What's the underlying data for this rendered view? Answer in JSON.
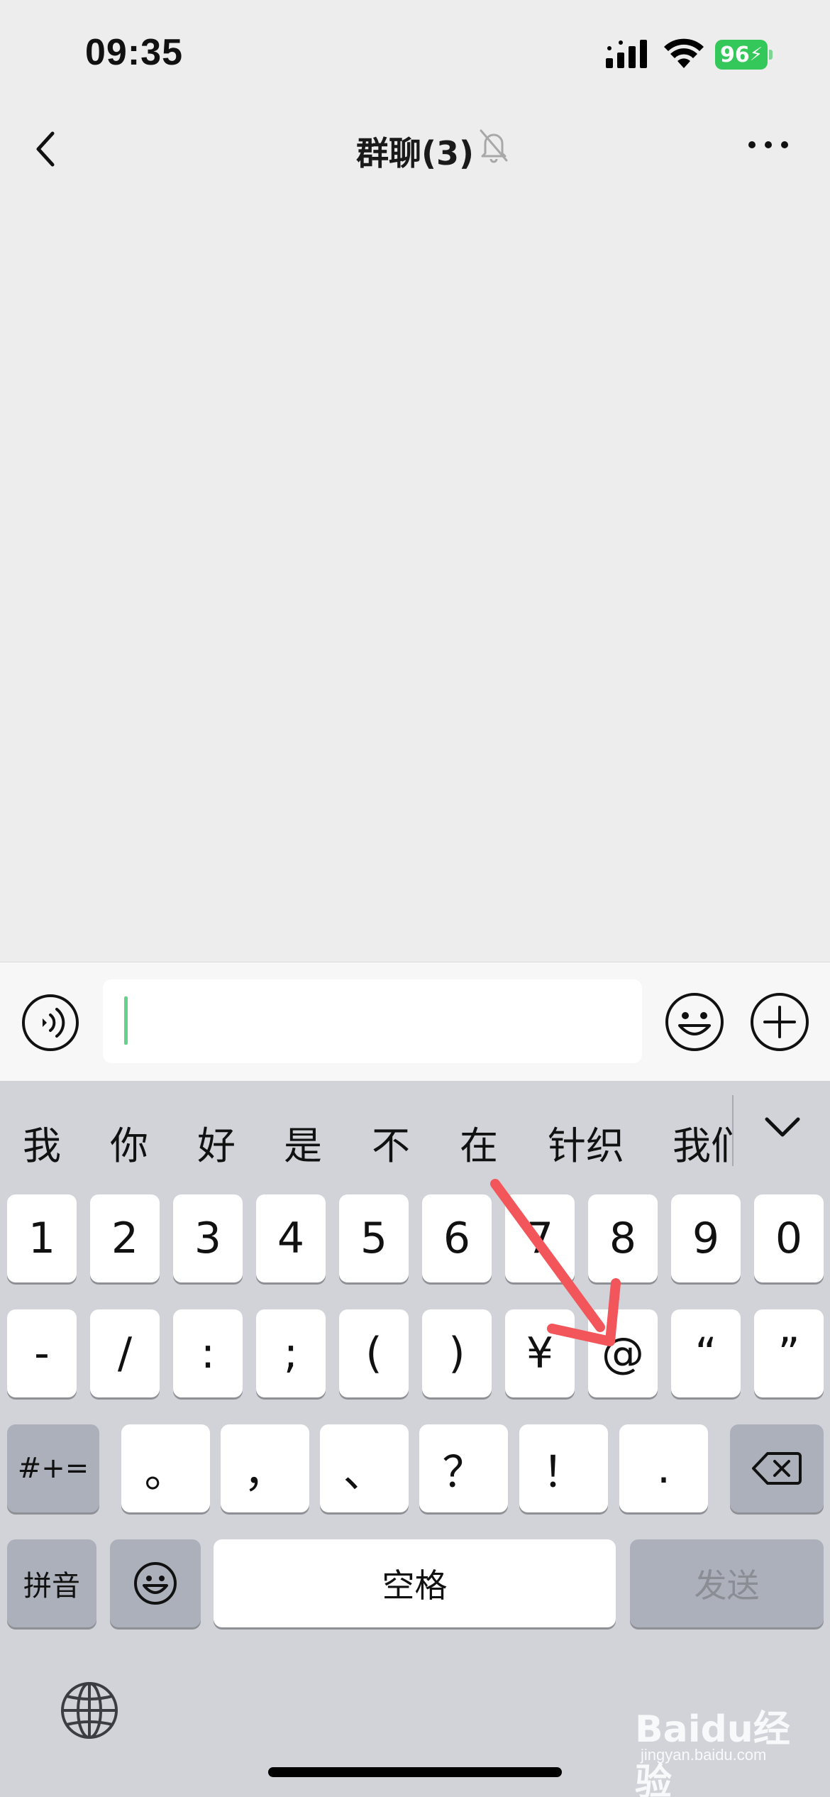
{
  "status_bar": {
    "time": "09:35",
    "battery_level": "96",
    "battery_color": "#34c759"
  },
  "nav": {
    "title": "群聊(3)",
    "back_icon": "chevron-left-icon",
    "mute_icon": "bell-slash-icon",
    "more_icon": "ellipsis-icon"
  },
  "input_bar": {
    "value": "",
    "caret_color": "#63d28a",
    "left_icon": "voice-icon",
    "right_icons": [
      "emoji-icon",
      "plus-circle-icon"
    ]
  },
  "keyboard": {
    "candidates": [
      "我",
      "你",
      "好",
      "是",
      "不",
      "在",
      "针织",
      "我们"
    ],
    "row1": [
      "1",
      "2",
      "3",
      "4",
      "5",
      "6",
      "7",
      "8",
      "9",
      "0"
    ],
    "row2": [
      "-",
      "/",
      ":",
      ";",
      "(",
      ")",
      "¥",
      "@",
      "“",
      "”"
    ],
    "row3": {
      "mode_key": "#+=",
      "keys": [
        "。",
        "，",
        "、",
        "？",
        "！",
        "."
      ],
      "delete_icon": "backspace-icon"
    },
    "row4": {
      "pinyin": "拼音",
      "emoji_icon": "emoji-icon",
      "space": "空格",
      "send": "发送"
    },
    "globe_icon": "globe-icon"
  },
  "annotation": {
    "color": "#f2555a",
    "points_to": "@"
  },
  "watermark": {
    "brand": "Bai",
    "brand_cn": "经验",
    "url": "jingyan.baidu.com"
  }
}
